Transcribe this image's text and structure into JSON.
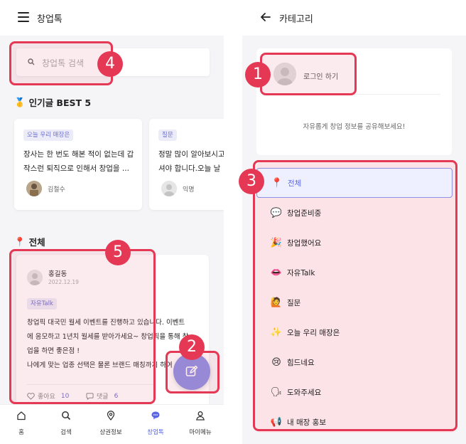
{
  "left": {
    "header": {
      "title": "창업톡",
      "menu_icon": "hamburger-icon"
    },
    "search": {
      "placeholder": "창업톡 검색",
      "icon": "search-icon"
    },
    "popular": {
      "medal": "🥇",
      "title": "인기글 BEST 5",
      "cards": [
        {
          "tag": "오늘 우리 매장은",
          "text": "장사는 한 번도 해본 적이 없는데 갑작스런 퇴직으로 인해서 창업을 ...",
          "author": "김철수"
        },
        {
          "tag": "질문",
          "text": "정말 많이 알아보시고 셔야 합니다.오늘 날",
          "author": "익명"
        }
      ]
    },
    "all_section": {
      "pin": "📍",
      "title": "전체"
    },
    "post": {
      "name": "홍길동",
      "date": "2022.12.19",
      "tag": "자유Talk",
      "lines": [
        "창업픽 대국민 월세 이벤트를 진행하고 있습니다.  이벤트",
        "에 응모하고 1년치 월세를 받아가세요~ 창업픽을 통해 창",
        "업을 하면 좋은점 !",
        "나에게 맞는 업종 선택은 물론 브랜드 매칭까지 하여"
      ],
      "like_label": "좋아요",
      "like_count": "10",
      "comment_label": "댓글",
      "comment_count": "6"
    },
    "fab_icon": "edit-icon",
    "bottom_nav": [
      {
        "label": "홈",
        "icon": "home-icon"
      },
      {
        "label": "검색",
        "icon": "search-icon"
      },
      {
        "label": "상권정보",
        "icon": "location-pin-icon"
      },
      {
        "label": "창업톡",
        "icon": "chat-bubble-icon",
        "active": true
      },
      {
        "label": "마이메뉴",
        "icon": "person-icon"
      }
    ]
  },
  "right": {
    "header": {
      "title": "카테고리",
      "back_icon": "arrow-left-icon"
    },
    "login": {
      "label": "로그인 하기",
      "description": "자유롭게 창업 정보를 공유해보세요!"
    },
    "categories": [
      {
        "emoji": "📍",
        "label": "전체",
        "active": true
      },
      {
        "emoji": "💬",
        "label": "창업준비중"
      },
      {
        "emoji": "🎉",
        "label": "창업했어요"
      },
      {
        "emoji": "👄",
        "label": "자유Talk"
      },
      {
        "emoji": "🙋",
        "label": "질문"
      },
      {
        "emoji": "✨",
        "label": "오늘 우리 매장은"
      },
      {
        "emoji": "😢",
        "label": "힘드네요"
      },
      {
        "emoji": "🗣",
        "label": "도와주세요"
      },
      {
        "emoji": "📢",
        "label": "내 매장 홍보"
      }
    ]
  },
  "annotations": [
    "1",
    "2",
    "3",
    "4",
    "5"
  ],
  "colors": {
    "accent": "#5b66e3",
    "fab": "#8d90e3",
    "highlight": "#e53855",
    "tag_bg": "#ececf9"
  }
}
